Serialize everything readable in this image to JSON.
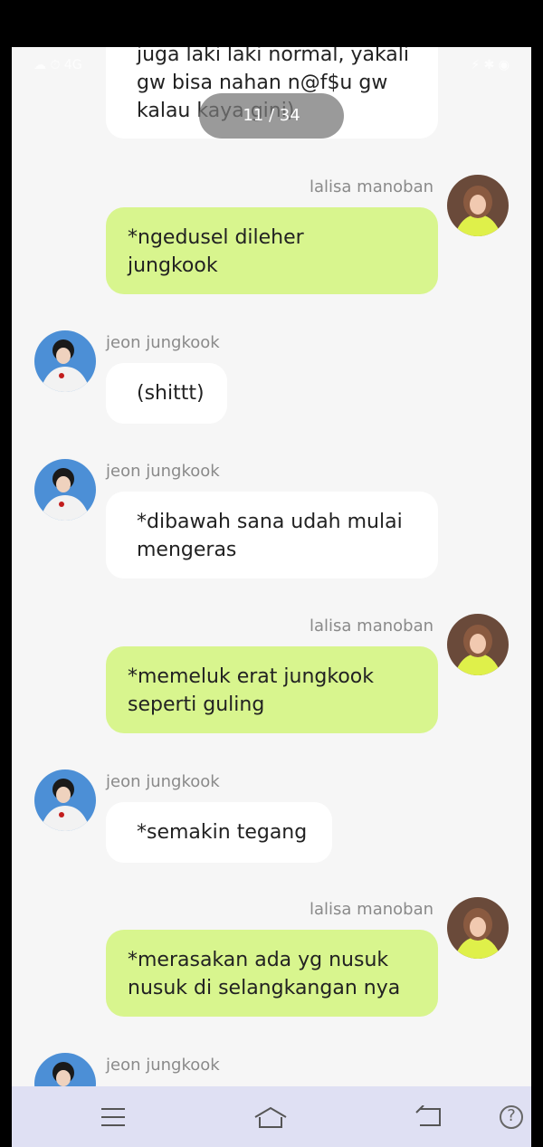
{
  "status_bar": {
    "left": "☁ ⏱ 4G",
    "right": "⚡ ✱ ◉"
  },
  "page_indicator": "11 / 34",
  "messages": [
    {
      "sender": "",
      "side": "left",
      "text": "juga laki laki normal, yakali\ngw bisa nahan n@f$u gw\nkalau kaya gini)"
    },
    {
      "sender": "lalisa manoban",
      "side": "right",
      "text": "*ngedusel dileher\njungkook"
    },
    {
      "sender": "jeon jungkook",
      "side": "left",
      "text": "(shittt)"
    },
    {
      "sender": "jeon jungkook",
      "side": "left",
      "text": "*dibawah sana udah mulai\nmengeras"
    },
    {
      "sender": "lalisa manoban",
      "side": "right",
      "text": "*memeluk erat jungkook\nseperti guling"
    },
    {
      "sender": "jeon jungkook",
      "side": "left",
      "text": "*semakin tegang"
    },
    {
      "sender": "lalisa manoban",
      "side": "right",
      "text": "*merasakan ada yg nusuk\nnusuk di selangkangan nya"
    },
    {
      "sender": "jeon jungkook",
      "side": "left",
      "text": ""
    }
  ],
  "nav": {
    "menu": "menu-icon",
    "home": "home-icon",
    "back": "back-icon",
    "help": "?"
  },
  "colors": {
    "user_bubble": "#d8f58e",
    "other_bubble": "#ffffff",
    "background": "#f6f6f6",
    "navbar": "#dfe0f3"
  }
}
